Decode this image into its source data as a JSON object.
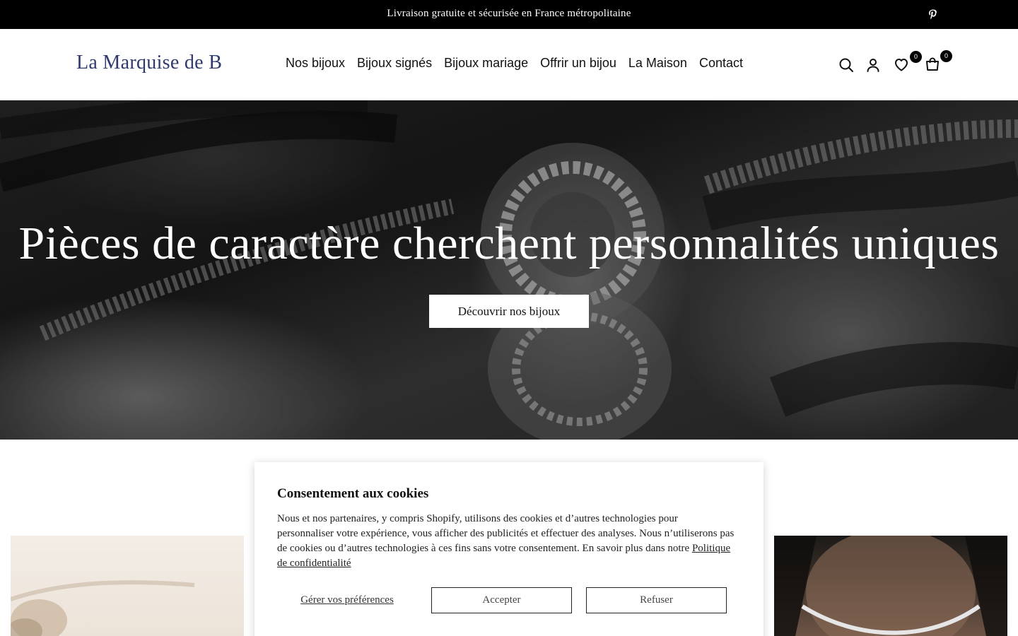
{
  "announcement": {
    "text": "Livraison gratuite et sécurisée en France métropolitaine",
    "social_icon": "pinterest-icon"
  },
  "header": {
    "logo": "La Marquise de B",
    "nav": [
      {
        "label": "Nos bijoux"
      },
      {
        "label": "Bijoux signés"
      },
      {
        "label": "Bijoux mariage"
      },
      {
        "label": "Offrir un bijou"
      },
      {
        "label": "La Maison"
      },
      {
        "label": "Contact"
      }
    ],
    "icons": [
      "search-icon",
      "account-icon",
      "wishlist-icon",
      "cart-icon"
    ],
    "wishlist_count": "0",
    "cart_count": "0"
  },
  "hero": {
    "title": "Pièces de caractère cherchent personnalités uniques",
    "button_label": "Découvrir nos bijoux"
  },
  "cookie_banner": {
    "title": "Consentement aux cookies",
    "body": "Nous et nos partenaires, y compris Shopify, utilisons des cookies et d’autres technologies pour personnaliser votre expérience, vous afficher des publicités et effectuer des analyses. Nous n’utiliserons pas de cookies ou d’autres technologies à ces fins sans votre consentement. En savoir plus dans notre ",
    "policy_link": "Politique de confidentialité",
    "manage_label": "Gérer vos préférences",
    "accept_label": "Accepter",
    "refuse_label": "Refuser"
  },
  "colors": {
    "announcement_bg": "#000000",
    "logo": "#2e3a6d",
    "badge_bg": "#000000"
  }
}
